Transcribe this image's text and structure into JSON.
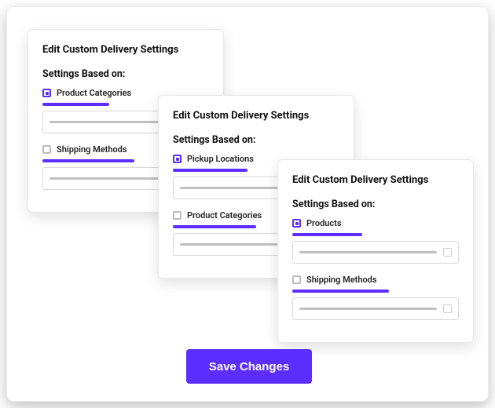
{
  "colors": {
    "accent": "#5B2EFF"
  },
  "cards": [
    {
      "title": "Edit Custom Delivery Settings",
      "subtitle": "Settings Based on:",
      "sections": [
        {
          "label": "Product Categories",
          "checked": true,
          "accent_pct": 40
        },
        {
          "label": "Shipping Methods",
          "checked": false,
          "accent_pct": 55
        }
      ]
    },
    {
      "title": "Edit Custom Delivery Settings",
      "subtitle": "Settings Based on:",
      "sections": [
        {
          "label": "Pickup Locations",
          "checked": true,
          "accent_pct": 45
        },
        {
          "label": "Product Categories",
          "checked": false,
          "accent_pct": 50
        }
      ]
    },
    {
      "title": "Edit Custom Delivery Settings",
      "subtitle": "Settings Based on:",
      "sections": [
        {
          "label": "Products",
          "checked": true,
          "accent_pct": 42
        },
        {
          "label": "Shipping Methods",
          "checked": false,
          "accent_pct": 58
        }
      ]
    }
  ],
  "save_button_label": "Save Changes"
}
